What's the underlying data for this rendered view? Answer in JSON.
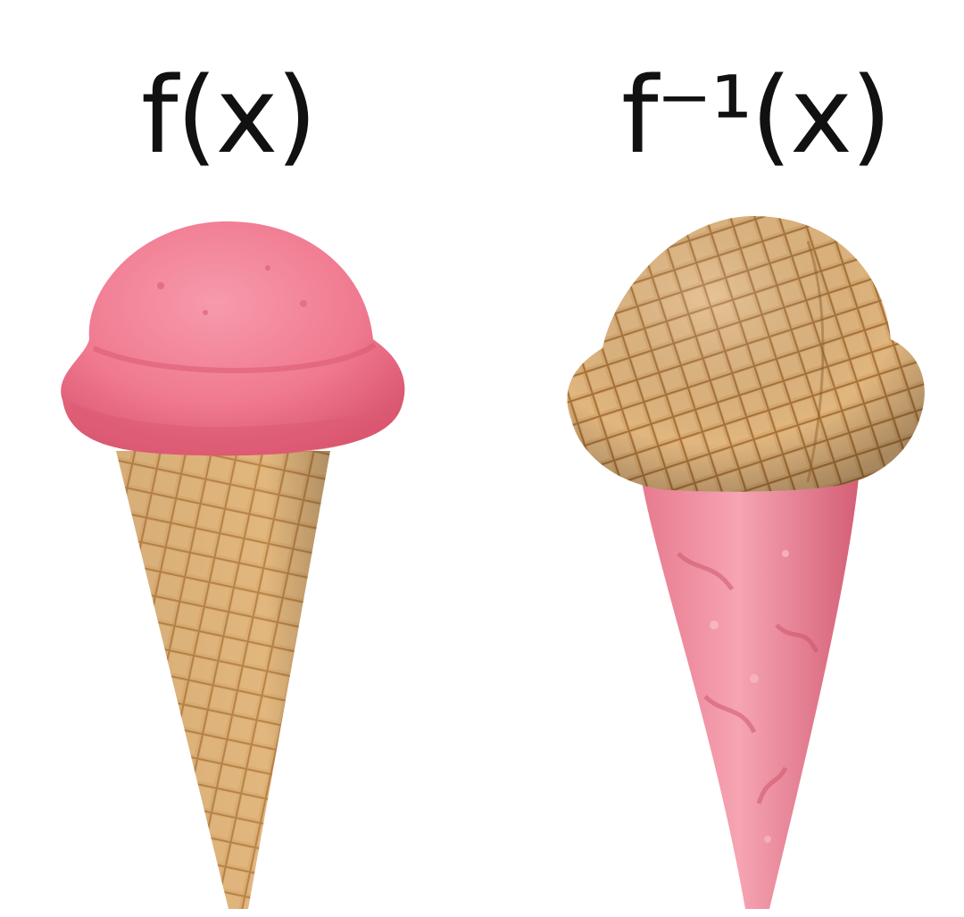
{
  "labels": {
    "left": "f(x)",
    "right": "f⁻¹(x)"
  },
  "colors": {
    "background": "#ffffff",
    "text": "#111111",
    "ice_cream_pink": "#f0788f",
    "ice_cream_pink_dark": "#d9546f",
    "waffle_cone": "#d9a86a",
    "waffle_cone_dark": "#b07a3e"
  },
  "panels": [
    {
      "name": "normal-ice-cream-cone"
    },
    {
      "name": "inverted-ice-cream-cone"
    }
  ]
}
